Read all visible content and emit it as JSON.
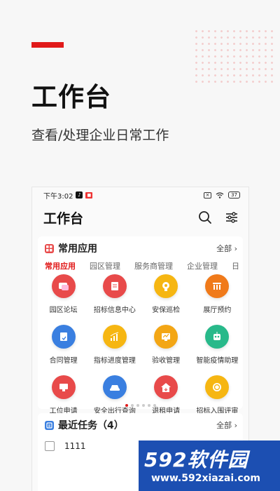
{
  "hero": {
    "title": "工作台",
    "subtitle": "查看/处理企业日常工作"
  },
  "phone": {
    "status": {
      "time": "下午3:02",
      "battery": "37"
    },
    "header": {
      "title": "工作台",
      "search_icon": "search-icon",
      "filter_icon": "filter-icon"
    },
    "common_apps": {
      "title": "常用应用",
      "more": "全部",
      "tabs": [
        "常用应用",
        "园区管理",
        "服务商管理",
        "企业管理",
        "日"
      ],
      "active_tab": 0,
      "items": [
        {
          "label": "园区论坛",
          "color": "#e84a4a",
          "icon": "chat-icon"
        },
        {
          "label": "招标信息中心",
          "color": "#e84a4a",
          "icon": "document-icon"
        },
        {
          "label": "安保巡检",
          "color": "#f6b612",
          "icon": "security-check-icon"
        },
        {
          "label": "展厅预约",
          "color": "#f07a1a",
          "icon": "hall-icon"
        },
        {
          "label": "合同管理",
          "color": "#3a7fe0",
          "icon": "contract-icon"
        },
        {
          "label": "指标进度管理",
          "color": "#f6b612",
          "icon": "chart-icon"
        },
        {
          "label": "验收管理",
          "color": "#f3a615",
          "icon": "acceptance-icon"
        },
        {
          "label": "智能疫情助理",
          "color": "#28b98a",
          "icon": "robot-icon"
        },
        {
          "label": "工位申请",
          "color": "#e84a4a",
          "icon": "monitor-icon"
        },
        {
          "label": "安全出行查询",
          "color": "#3a7fe0",
          "icon": "car-icon"
        },
        {
          "label": "退租申请",
          "color": "#e84a4a",
          "icon": "house-icon"
        },
        {
          "label": "招标入围评审",
          "color": "#f6b612",
          "icon": "award-icon"
        }
      ],
      "pager_total": 6,
      "pager_active": 0
    },
    "recent_tasks": {
      "title": "最近任务（4）",
      "more": "全部",
      "items": [
        {
          "text": "1111"
        }
      ]
    }
  },
  "watermark": {
    "brand": "592软件园",
    "url": "www.592xiazai.com"
  },
  "colors": {
    "accent": "#e11a1a",
    "watermark_bg": "#1c4fb2"
  }
}
